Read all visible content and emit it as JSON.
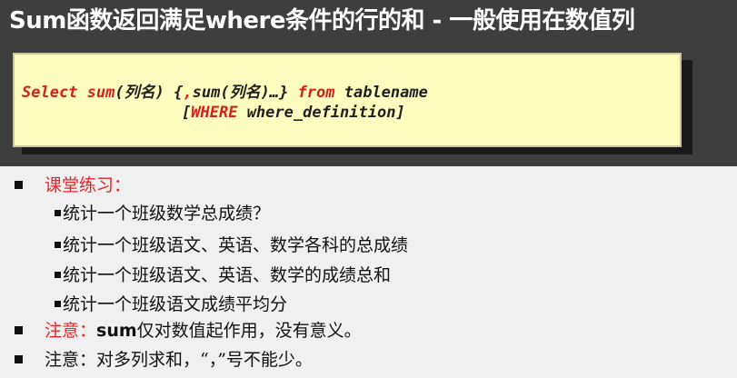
{
  "title": "Sum函数返回满足where条件的行的和 - 一般使用在数值列",
  "code": {
    "kw_select": "Select",
    "kw_sum1": "sum",
    "arg1": "(列名)",
    "brace_open": " {",
    "comma": ",",
    "sum2": "sum",
    "arg2": "(列名)…}",
    "kw_from": "from",
    "table": "tablename",
    "bracket_open": "[",
    "kw_where": "WHERE",
    "where_def": "where_definition",
    "bracket_close": "]"
  },
  "exercise": {
    "heading": "课堂练习：",
    "items": [
      "统计一个班级数学总成绩？",
      "统计一个班级语文、英语、数学各科的总成绩",
      "统计一个班级语文、英语、数学的成绩总和",
      "统计一个班级语文成绩平均分"
    ]
  },
  "note1": {
    "label": "注意：",
    "keyword": "sum",
    "text": "仅对数值起作用，没有意义。"
  },
  "note2": {
    "text": "注意：对多列求和，“，”号不能少。"
  },
  "colors": {
    "background": "#3e3e3e",
    "code_box": "#fefcbf",
    "accent_red": "#e8262a",
    "panel": "#f0f0f0"
  }
}
